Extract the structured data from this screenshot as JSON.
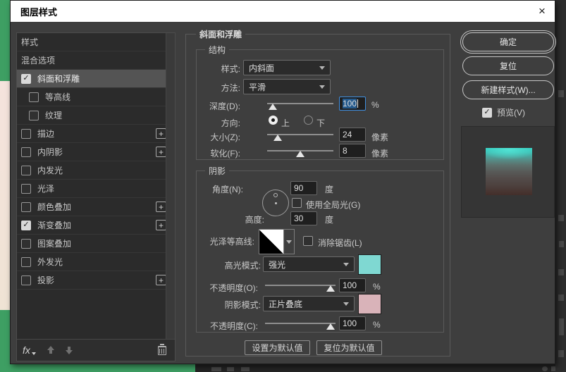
{
  "window": {
    "title": "图层样式",
    "close": "×"
  },
  "sidebar": {
    "items": [
      {
        "label": "样式"
      },
      {
        "label": "混合选项"
      },
      {
        "label": "斜面和浮雕"
      },
      {
        "label": "等高线"
      },
      {
        "label": "纹理"
      },
      {
        "label": "描边"
      },
      {
        "label": "内阴影"
      },
      {
        "label": "内发光"
      },
      {
        "label": "光泽"
      },
      {
        "label": "颜色叠加"
      },
      {
        "label": "渐变叠加"
      },
      {
        "label": "图案叠加"
      },
      {
        "label": "外发光"
      },
      {
        "label": "投影"
      }
    ],
    "fx_label": "fx"
  },
  "panel": {
    "title": "斜面和浮雕",
    "structure": {
      "legend": "结构",
      "style_label": "样式:",
      "style_value": "内斜面",
      "method_label": "方法:",
      "method_value": "平滑",
      "depth_label": "深度(D):",
      "depth_value": "100",
      "depth_unit": "%",
      "direction_label": "方向:",
      "up": "上",
      "down": "下",
      "size_label": "大小(Z):",
      "size_value": "24",
      "size_unit": "像素",
      "soften_label": "软化(F):",
      "soften_value": "8",
      "soften_unit": "像素"
    },
    "shading": {
      "legend": "阴影",
      "angle_label": "角度(N):",
      "angle_value": "90",
      "angle_unit": "度",
      "global_light": "使用全局光(G)",
      "altitude_label": "高度:",
      "altitude_value": "30",
      "altitude_unit": "度",
      "gloss_label": "光泽等高线:",
      "antialias": "消除锯齿(L)",
      "highlight_label": "高光模式:",
      "highlight_value": "强光",
      "highlight_color": "#7fd8d2",
      "opacity_o_label": "不透明度(O):",
      "opacity_o_value": "100",
      "opacity_o_unit": "%",
      "shadow_label": "阴影模式:",
      "shadow_value": "正片叠底",
      "shadow_color": "#d9b3b9",
      "opacity_c_label": "不透明度(C):",
      "opacity_c_value": "100",
      "opacity_c_unit": "%"
    },
    "set_default": "设置为默认值",
    "reset_default": "复位为默认值"
  },
  "actions": {
    "ok": "确定",
    "reset": "复位",
    "new_style": "新建样式(W)...",
    "preview": "预览(V)"
  }
}
